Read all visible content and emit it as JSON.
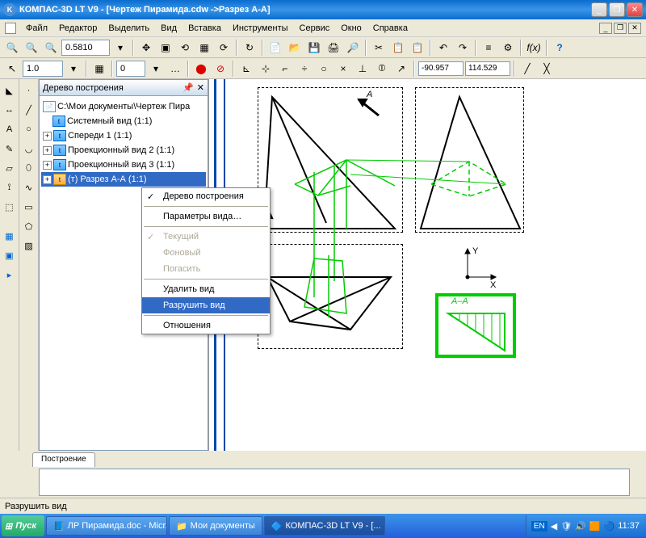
{
  "titlebar": {
    "app_icon": "K",
    "title": "КОМПАС-3D LT V9 - [Чертеж Пирамида.cdw ->Разрез А-А]"
  },
  "menu": {
    "file": "Файл",
    "edit": "Редактор",
    "select": "Выделить",
    "view": "Вид",
    "insert": "Вставка",
    "tools": "Инструменты",
    "service": "Сервис",
    "window": "Окно",
    "help": "Справка"
  },
  "toolbar1": {
    "zoom": "0.5810"
  },
  "toolbar2": {
    "scale": "1.0",
    "layer": "0",
    "coord_x": "-90.957",
    "coord_y": "114.529"
  },
  "tree": {
    "title": "Дерево построения",
    "root": "C:\\Мои документы\\Чертеж Пира",
    "items": [
      "Системный вид (1:1)",
      "Спереди 1 (1:1)",
      "Проекционный вид 2 (1:1)",
      "Проекционный вид 3 (1:1)",
      "(т) Разрез А-А (1:1)"
    ]
  },
  "context_menu": {
    "tree": "Дерево построения",
    "params": "Параметры вида…",
    "current": "Текущий",
    "background": "Фоновый",
    "hide": "Погасить",
    "delete": "Удалить вид",
    "destroy": "Разрушить вид",
    "relations": "Отношения"
  },
  "canvas": {
    "section_label": "А",
    "section_title": "А–А",
    "axis_x": "X",
    "axis_y": "Y"
  },
  "tab": {
    "build": "Построение"
  },
  "status": {
    "text": "Разрушить вид"
  },
  "taskbar": {
    "start": "Пуск",
    "task1": "ЛР Пирамида.doc - Micr...",
    "task2": "Мои документы",
    "task3": "КОМПАС-3D LT V9 - [...",
    "lang": "EN",
    "time": "11:37"
  }
}
